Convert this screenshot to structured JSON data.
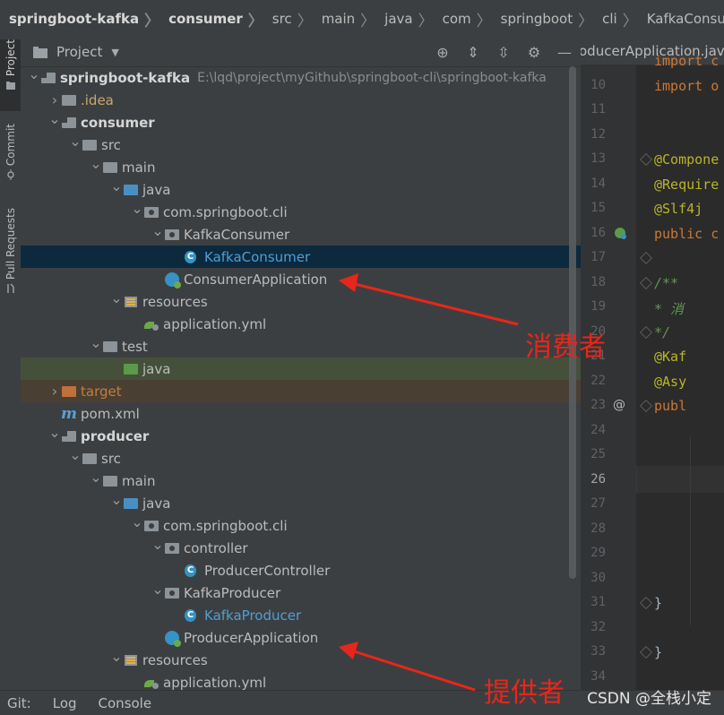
{
  "breadcrumb": {
    "items": [
      "springboot-kafka",
      "consumer",
      "src",
      "main",
      "java",
      "com",
      "springboot",
      "cli",
      "KafkaConsumer",
      "KafkaCo"
    ]
  },
  "left_strip": {
    "tabs": [
      {
        "label": "Project",
        "active": true
      },
      {
        "label": "Commit",
        "active": false
      },
      {
        "label": "Pull Requests",
        "active": false
      }
    ]
  },
  "project_panel": {
    "title": "Project",
    "tree": [
      {
        "depth": 0,
        "arrow": "down",
        "icon": "module-folder",
        "label": "springboot-kafka",
        "bold": true,
        "path": "E:\\lqd\\project\\myGithub\\springboot-cli\\springboot-kafka"
      },
      {
        "depth": 1,
        "arrow": "right",
        "icon": "idea-folder",
        "label": ".idea",
        "style": "idea"
      },
      {
        "depth": 1,
        "arrow": "down",
        "icon": "module-folder",
        "label": "consumer",
        "bold": true
      },
      {
        "depth": 2,
        "arrow": "down",
        "icon": "folder",
        "label": "src"
      },
      {
        "depth": 3,
        "arrow": "down",
        "icon": "folder",
        "label": "main"
      },
      {
        "depth": 4,
        "arrow": "down",
        "icon": "source-folder",
        "label": "java"
      },
      {
        "depth": 5,
        "arrow": "down",
        "icon": "package",
        "label": "com.springboot.cli"
      },
      {
        "depth": 6,
        "arrow": "down",
        "icon": "package",
        "label": "KafkaConsumer"
      },
      {
        "depth": 7,
        "arrow": "none",
        "icon": "class",
        "label": "KafkaConsumer",
        "style": "kotlinblue",
        "selected": true
      },
      {
        "depth": 6,
        "arrow": "none",
        "icon": "app-class",
        "label": "ConsumerApplication"
      },
      {
        "depth": 4,
        "arrow": "down",
        "icon": "resources",
        "label": "resources"
      },
      {
        "depth": 5,
        "arrow": "none",
        "icon": "yml",
        "label": "application.yml"
      },
      {
        "depth": 3,
        "arrow": "down",
        "icon": "folder",
        "label": "test"
      },
      {
        "depth": 4,
        "arrow": "none",
        "icon": "test-folder",
        "label": "java",
        "highlight": "test"
      },
      {
        "depth": 1,
        "arrow": "right",
        "icon": "excluded-folder",
        "label": "target",
        "style": "target",
        "highlight": "excluded"
      },
      {
        "depth": 1,
        "arrow": "none",
        "icon": "maven",
        "label": "pom.xml"
      },
      {
        "depth": 1,
        "arrow": "down",
        "icon": "module-folder",
        "label": "producer",
        "bold": true
      },
      {
        "depth": 2,
        "arrow": "down",
        "icon": "folder",
        "label": "src"
      },
      {
        "depth": 3,
        "arrow": "down",
        "icon": "folder",
        "label": "main"
      },
      {
        "depth": 4,
        "arrow": "down",
        "icon": "source-folder",
        "label": "java"
      },
      {
        "depth": 5,
        "arrow": "down",
        "icon": "package",
        "label": "com.springboot.cli"
      },
      {
        "depth": 6,
        "arrow": "down",
        "icon": "package",
        "label": "controller"
      },
      {
        "depth": 7,
        "arrow": "none",
        "icon": "class",
        "label": "ProducerController"
      },
      {
        "depth": 6,
        "arrow": "down",
        "icon": "package",
        "label": "KafkaProducer"
      },
      {
        "depth": 7,
        "arrow": "none",
        "icon": "class",
        "label": "KafkaProducer",
        "style": "kotlinblue"
      },
      {
        "depth": 6,
        "arrow": "none",
        "icon": "app-class",
        "label": "ProducerApplication"
      },
      {
        "depth": 4,
        "arrow": "down",
        "icon": "resources",
        "label": "resources"
      },
      {
        "depth": 5,
        "arrow": "none",
        "icon": "yml",
        "label": "application.yml"
      }
    ]
  },
  "editor": {
    "tab_label": "oducerApplication.java",
    "lines": [
      {
        "n": "",
        "code": "import c",
        "cls": "kw"
      },
      {
        "n": "10",
        "code": "import o",
        "cls": "kw"
      },
      {
        "n": "11",
        "code": ""
      },
      {
        "n": "12",
        "code": ""
      },
      {
        "n": "13",
        "code": "@Compone",
        "cls": "ann"
      },
      {
        "n": "14",
        "code": "@Require",
        "cls": "ann"
      },
      {
        "n": "15",
        "code": "@Slf4j",
        "cls": "ann"
      },
      {
        "n": "16",
        "code": "public c",
        "cls": "kw",
        "mark": "bean"
      },
      {
        "n": "17",
        "code": ""
      },
      {
        "n": "18",
        "code": "    /**",
        "cls": "cmt"
      },
      {
        "n": "19",
        "code": "     * 消",
        "cls": "cmt"
      },
      {
        "n": "20",
        "code": "     */",
        "cls": "cmt"
      },
      {
        "n": "21",
        "code": "    @Kaf",
        "cls": "ann"
      },
      {
        "n": "22",
        "code": "    @Asy",
        "cls": "ann"
      },
      {
        "n": "23",
        "code": "    publ",
        "cls": "kw",
        "mark": "@"
      },
      {
        "n": "24",
        "code": ""
      },
      {
        "n": "25",
        "code": ""
      },
      {
        "n": "26",
        "code": "",
        "current": true
      },
      {
        "n": "27",
        "code": ""
      },
      {
        "n": "28",
        "code": ""
      },
      {
        "n": "29",
        "code": ""
      },
      {
        "n": "30",
        "code": ""
      },
      {
        "n": "31",
        "code": "    }",
        "cls": "plain"
      },
      {
        "n": "32",
        "code": ""
      },
      {
        "n": "33",
        "code": "}",
        "cls": "plain"
      },
      {
        "n": "34",
        "code": ""
      }
    ]
  },
  "bottom_bar": {
    "items": [
      "Git:",
      "Log",
      "Console"
    ]
  },
  "annotations": {
    "consumer": "消费者",
    "producer": "提供者",
    "watermark": "CSDN @全栈小定"
  }
}
